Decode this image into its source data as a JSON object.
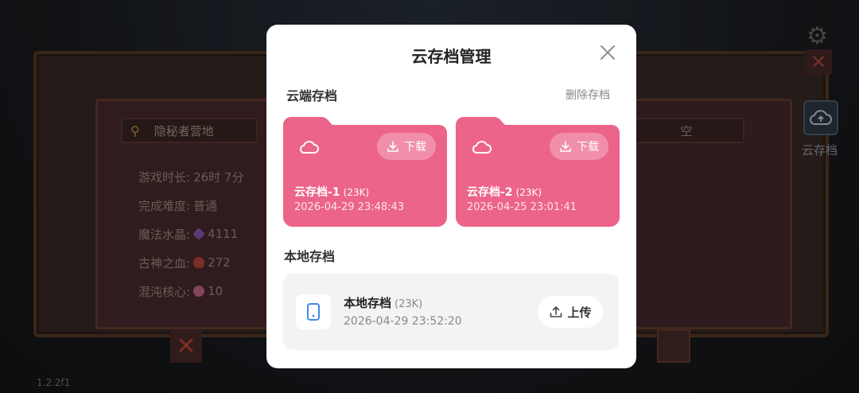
{
  "background": {
    "location_label": "隐秘者营地",
    "empty_slot_label": "空",
    "stats": [
      {
        "label": "游戏时长:",
        "value": "26时 7分"
      },
      {
        "label": "完成难度:",
        "value": "普通"
      },
      {
        "label": "魔法水晶:",
        "value": "4111"
      },
      {
        "label": "古神之血:",
        "value": "272"
      },
      {
        "label": "混沌核心:",
        "value": "10"
      }
    ],
    "side_cloud_label": "云存档",
    "version": "1.2.2f1"
  },
  "modal": {
    "title": "云存档管理",
    "cloud_section_title": "云端存档",
    "delete_label": "删除存档",
    "cloud_saves": [
      {
        "name": "云存档-1",
        "size": "(23K)",
        "date": "2026-04-29 23:48:43",
        "download_label": "下载"
      },
      {
        "name": "云存档-2",
        "size": "(23K)",
        "date": "2026-04-25 23:01:41",
        "download_label": "下载"
      }
    ],
    "local_section_title": "本地存档",
    "local_save": {
      "name": "本地存档",
      "size": "(23K)",
      "date": "2026-04-29 23:52:20",
      "upload_label": "上传"
    }
  },
  "colors": {
    "card_pink": "#ec6489",
    "modal_bg": "#ffffff",
    "local_bg": "#f2f3f5"
  }
}
